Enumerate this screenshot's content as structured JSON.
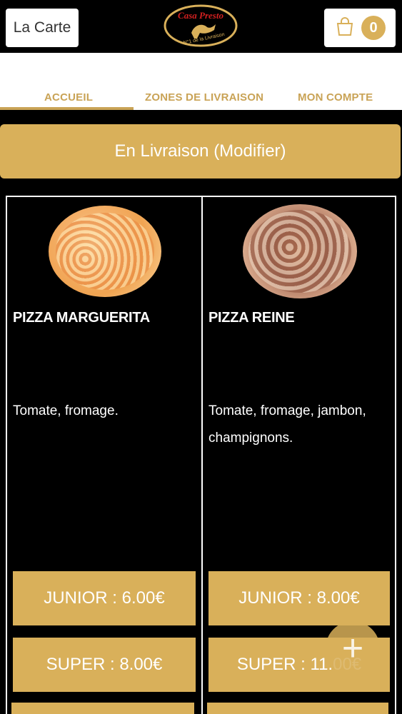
{
  "header": {
    "menu_label": "La Carte",
    "logo_text_top": "Casa Presto",
    "logo_text_bottom": "N°1 de la Livraison",
    "cart_count": "0"
  },
  "tabs": [
    {
      "label": "ACCUEIL",
      "active": true
    },
    {
      "label": "ZONES DE LIVRAISON",
      "active": false
    },
    {
      "label": "MON COMPTE",
      "active": false
    }
  ],
  "delivery_label": "En Livraison (Modifier)",
  "products": [
    {
      "name": "PIZZA MARGUERITA",
      "description_lines": [
        "Tomate, fromage."
      ],
      "prices": [
        "JUNIOR : 6.00€",
        "SUPER : 8.00€"
      ]
    },
    {
      "name": "PIZZA REINE",
      "description_lines": [
        "Tomate, fromage, jambon,",
        "champignons."
      ],
      "prices": [
        "JUNIOR : 8.00€",
        "SUPER : 11.00€"
      ]
    }
  ],
  "fab_icon": "plus-icon",
  "colors": {
    "accent": "#d9b05a",
    "tab_text": "#c9a356",
    "background": "#000000"
  }
}
